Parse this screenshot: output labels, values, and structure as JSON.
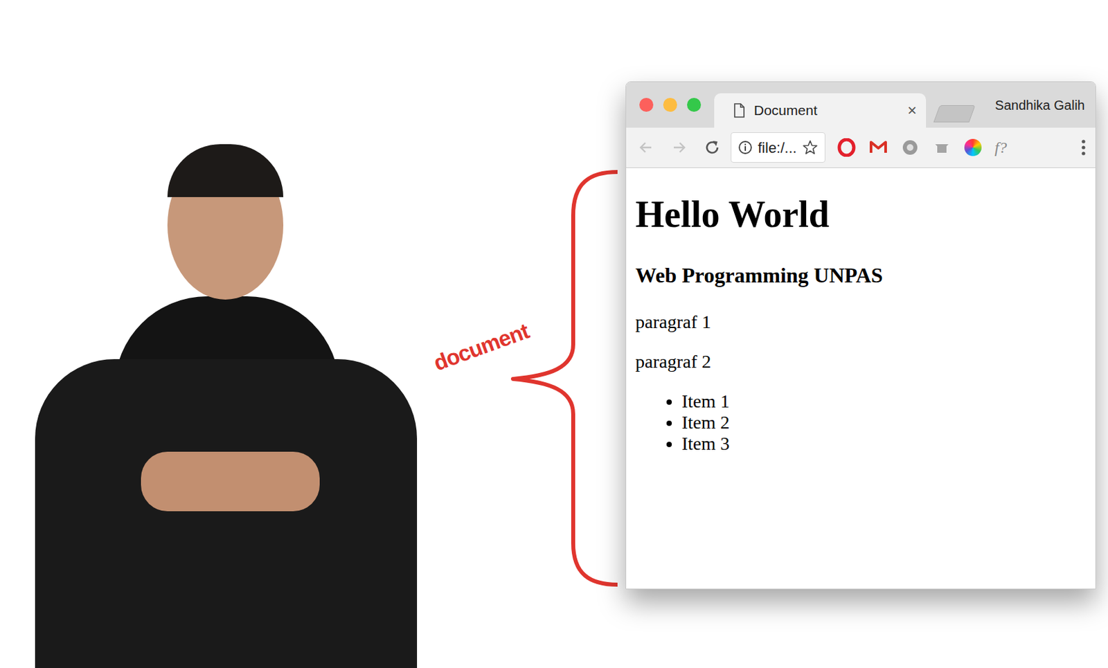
{
  "slide_label": "document",
  "browser": {
    "tab": {
      "title": "Document",
      "close": "×",
      "selected": true
    },
    "profile": "Sandhika Galih",
    "address": "file:/...",
    "extension_label": "f?",
    "page": {
      "heading": "Hello World",
      "subheading": "Web Programming UNPAS",
      "paragraphs": [
        "paragraf 1",
        "paragraf 2"
      ],
      "list": [
        "Item 1",
        "Item 2",
        "Item 3"
      ]
    }
  }
}
